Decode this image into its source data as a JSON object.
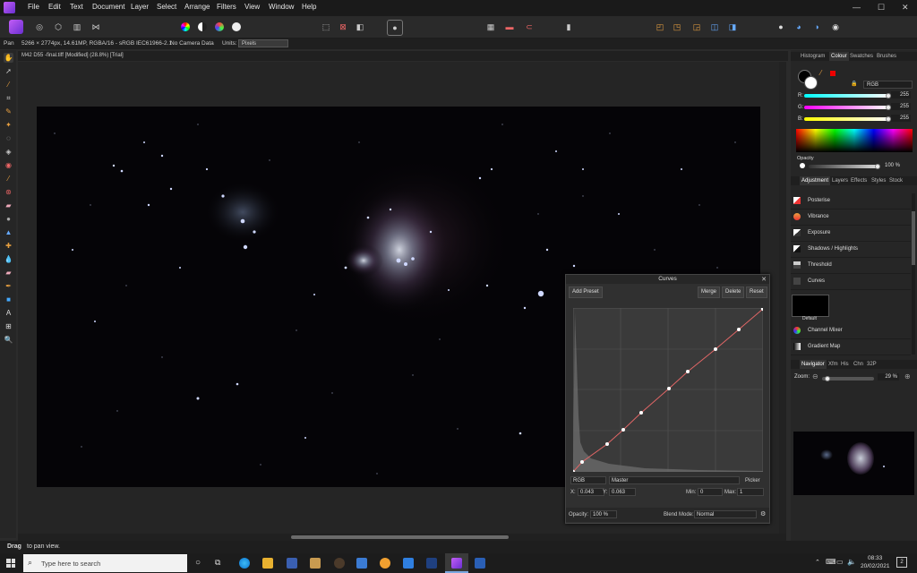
{
  "colors": {
    "accent": "#a64bf4",
    "panel": "#262626",
    "curve": "#e06666"
  },
  "menu": [
    "File",
    "Edit",
    "Text",
    "Document",
    "Layer",
    "Select",
    "Arrange",
    "Filters",
    "View",
    "Window",
    "Help"
  ],
  "window_controls": {
    "minimize": "—",
    "maximize": "☐",
    "close": "✕"
  },
  "context": {
    "tool_name": "Pan",
    "doc_info": "5266 × 2774px, 14.61MP, RGBA/16 - sRGB IEC61966-2.1",
    "camera": "No Camera Data",
    "units_label": "Units:",
    "units_value": "Pixels"
  },
  "document_tab": "M42 D55 -final.tiff [Modified] (28.8%) [Trial]",
  "status_hint_bold": "Drag",
  "status_hint": " to pan view.",
  "right_panel": {
    "top_tabs": [
      "Histogram",
      "Colour",
      "Swatches",
      "Brushes"
    ],
    "colour_model": "RGB",
    "channels": [
      {
        "label": "R:",
        "value": "255"
      },
      {
        "label": "G:",
        "value": "255"
      },
      {
        "label": "B:",
        "value": "255"
      }
    ],
    "opacity_label": "Opacity",
    "opacity_value": "100 %",
    "mid_tabs": [
      "Adjustment",
      "Layers",
      "Effects",
      "Styles",
      "Stock"
    ],
    "adjustments": [
      "Posterise",
      "Vibrance",
      "Exposure",
      "Shadows / Highlights",
      "Threshold",
      "Curves"
    ],
    "preset_label": "Default",
    "adjustments_more": [
      "Channel Mixer",
      "Gradient Map"
    ],
    "nav_tabs": [
      "Navigator",
      "Xfm",
      "His",
      "Chn",
      "32P"
    ],
    "zoom_label": "Zoom:",
    "zoom_value": "29 %"
  },
  "curves": {
    "title": "Curves",
    "add_preset": "Add Preset",
    "merge": "Merge",
    "delete": "Delete",
    "reset": "Reset",
    "model": "RGB",
    "channel": "Master",
    "picker": "Picker",
    "x_label": "X:",
    "x_value": "0.043",
    "y_label": "Y:",
    "y_value": "0.063",
    "min_label": "Min:",
    "min_value": "0",
    "max_label": "Max:",
    "max_value": "1",
    "opacity_label": "Opacity:",
    "opacity_value": "100 %",
    "blend_label": "Blend Mode:",
    "blend_value": "Normal"
  },
  "taskbar": {
    "search_placeholder": "Type here to search",
    "time": "08:33",
    "date": "20/02/2021",
    "notifications": "2"
  }
}
